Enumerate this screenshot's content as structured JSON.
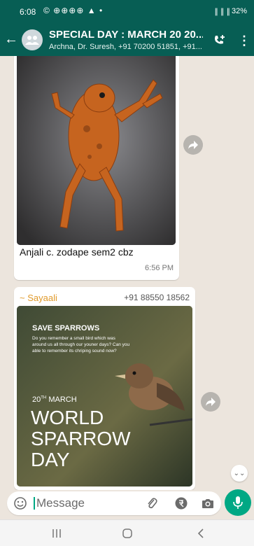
{
  "status_bar": {
    "time": "6:08",
    "left_icons": "© ⊕⊕⊕⊕ ▲ •",
    "right_icons": "∥ ∥ ∥",
    "battery": "32%"
  },
  "header": {
    "title": "SPECIAL DAY : MARCH 20 20...",
    "subtitle": "Archna, Dr. Suresh, +91 70200 51851, +91..."
  },
  "messages": [
    {
      "type": "image",
      "image_desc": "frog",
      "caption": "Anjali c. zodape sem2 cbz",
      "time": "6:56 PM"
    },
    {
      "type": "image",
      "sender": "~ Sayaali",
      "phone": "+91 88550 18562",
      "poster": {
        "heading": "SAVE SPARROWS",
        "body": "Do you remember a small bird which was around us all through our youner days? Can you able to remember its chriping sound now?",
        "date_num": "20",
        "date_sup": "TH",
        "date_month": "MARCH",
        "line1": "WORLD",
        "line2": "SPARROW",
        "line3": "DAY"
      }
    }
  ],
  "input": {
    "placeholder": "Message"
  },
  "colors": {
    "header": "#075e54",
    "accent": "#00a884",
    "sender": "#e09a2b",
    "chat_bg": "#ece5dd"
  }
}
